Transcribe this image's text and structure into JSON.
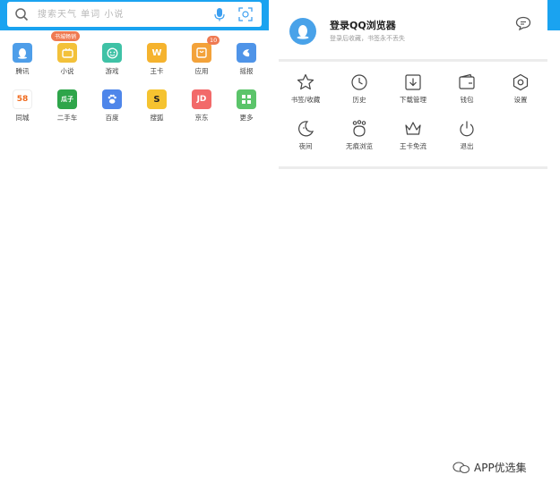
{
  "search": {
    "placeholder": "搜索天气 单词 小说"
  },
  "apps": [
    {
      "label": "腾讯",
      "color": "#4e9ee9",
      "glyph": "",
      "icon": "qq-penguin-icon"
    },
    {
      "label": "小说",
      "color": "#f3c13a",
      "glyph": "",
      "icon": "tv-book-icon",
      "badge": "书城畅销"
    },
    {
      "label": "游戏",
      "color": "#3fc2a6",
      "glyph": "",
      "icon": "smile-game-icon"
    },
    {
      "label": "王卡",
      "color": "#f5b32e",
      "glyph": "W",
      "icon": "wangka-icon"
    },
    {
      "label": "应用",
      "color": "#f3a23a",
      "glyph": "",
      "icon": "app-store-icon",
      "badge_count": "10"
    },
    {
      "label": "摇报",
      "color": "#4f94e8",
      "glyph": "",
      "icon": "shake-news-icon"
    },
    {
      "label": "同城",
      "color": "#ffffff",
      "glyph": "58",
      "icon": "58-tongcheng-icon"
    },
    {
      "label": "二手车",
      "color": "#2ea54a",
      "glyph": "瓜子",
      "icon": "guazi-car-icon"
    },
    {
      "label": "百度",
      "color": "#4e86ea",
      "glyph": "",
      "icon": "baidu-paw-icon"
    },
    {
      "label": "搜狐",
      "color": "#f5c330",
      "glyph": "S",
      "icon": "sohu-icon"
    },
    {
      "label": "京东",
      "color": "#f26a6a",
      "glyph": "JD",
      "icon": "jd-icon"
    },
    {
      "label": "更多",
      "color": "#5bc46a",
      "glyph": "",
      "icon": "more-grid-icon"
    }
  ],
  "login": {
    "title": "登录QQ浏览器",
    "subtitle": "登录后收藏，书签永不丢失"
  },
  "menu": [
    {
      "label": "书签/收藏",
      "icon": "star-icon"
    },
    {
      "label": "历史",
      "icon": "clock-icon"
    },
    {
      "label": "下载管理",
      "icon": "download-icon"
    },
    {
      "label": "钱包",
      "icon": "wallet-icon"
    },
    {
      "label": "设置",
      "icon": "settings-hexagon-icon"
    },
    {
      "label": "夜间",
      "icon": "moon-icon"
    },
    {
      "label": "无痕浏览",
      "icon": "incognito-icon"
    },
    {
      "label": "王卡免流",
      "icon": "crown-icon"
    },
    {
      "label": "退出",
      "icon": "power-icon"
    }
  ],
  "watermark": {
    "text": "APP优选集"
  },
  "colors": {
    "accent": "#1aa3f0",
    "badge": "#ef7a52"
  }
}
